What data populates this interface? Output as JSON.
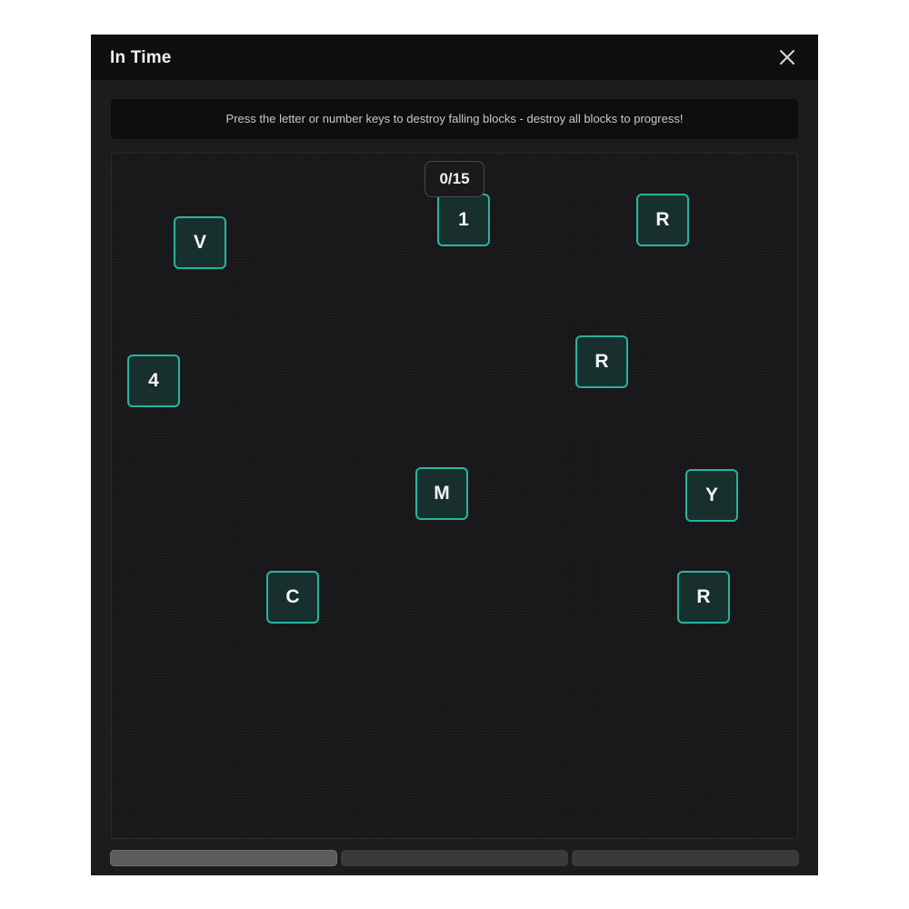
{
  "window": {
    "title": "In Time",
    "close_icon": "close-icon"
  },
  "instructions": "Press the letter or number keys to destroy falling blocks - destroy all blocks to progress!",
  "counter": "0/15",
  "blocks": [
    {
      "label": "V"
    },
    {
      "label": "1"
    },
    {
      "label": "R"
    },
    {
      "label": "4"
    },
    {
      "label": "R"
    },
    {
      "label": "M"
    },
    {
      "label": "Y"
    },
    {
      "label": "C"
    },
    {
      "label": "R"
    }
  ],
  "progress": {
    "segments": 3,
    "active_segment": 1
  },
  "colors": {
    "block_border": "#2ab3a0",
    "block_fill": "#18302d",
    "window_bg": "#1c1c1e",
    "titlebar_bg": "#0f0f11"
  }
}
